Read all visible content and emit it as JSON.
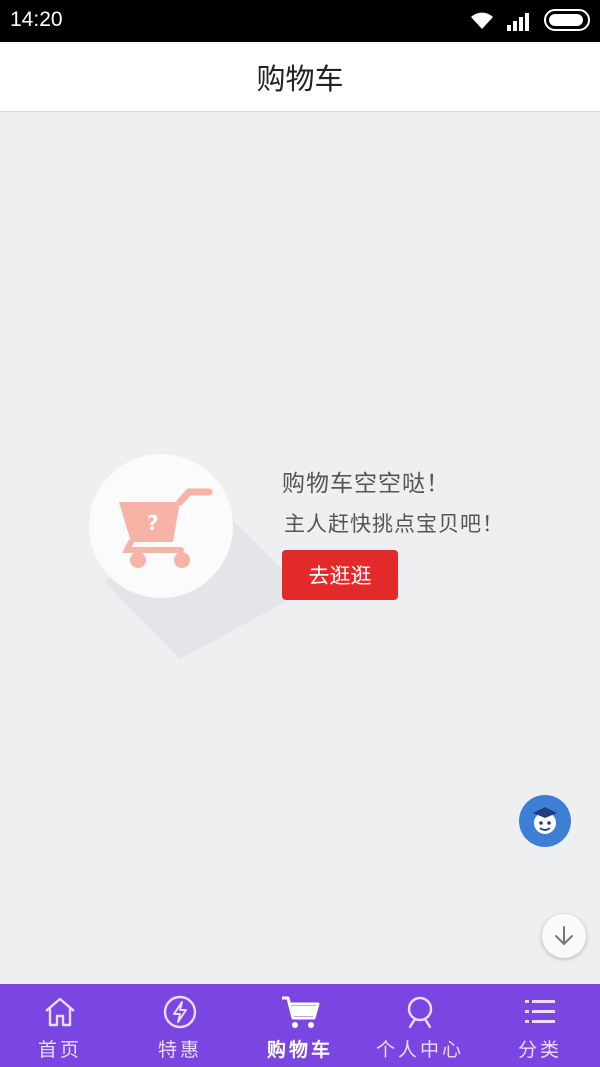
{
  "status_bar": {
    "time": "14:20"
  },
  "header": {
    "title": "购物车"
  },
  "empty_state": {
    "line1": "购物车空空哒！",
    "line2": "主人赶快挑点宝贝吧！",
    "button": "去逛逛",
    "icon": "empty-cart-icon"
  },
  "tabs": [
    {
      "label": "首页",
      "icon": "home-icon",
      "active": false
    },
    {
      "label": "特惠",
      "icon": "lightning-icon",
      "active": false
    },
    {
      "label": "购物车",
      "icon": "cart-icon",
      "active": true
    },
    {
      "label": "个人中心",
      "icon": "person-icon",
      "active": false
    },
    {
      "label": "分类",
      "icon": "list-icon",
      "active": false
    }
  ],
  "colors": {
    "tabbar": "#7b45e1",
    "button": "#e32a2a",
    "background": "#eeeff1",
    "avatar_button": "#3d7fd6"
  }
}
